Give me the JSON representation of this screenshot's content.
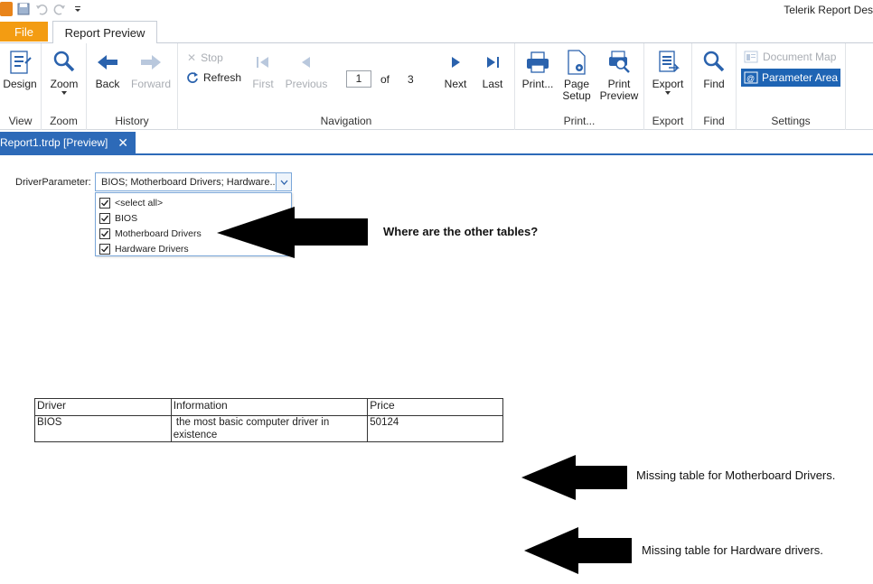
{
  "window": {
    "title": "Telerik Report Des"
  },
  "ribbon_tabs": {
    "file": "File",
    "active": "Report Preview"
  },
  "ribbon": {
    "view": {
      "design": "Design",
      "group": "View"
    },
    "zoom": {
      "zoom": "Zoom",
      "group": "Zoom"
    },
    "history": {
      "back": "Back",
      "forward": "Forward",
      "group": "History"
    },
    "navigation": {
      "stop": "Stop",
      "refresh": "Refresh",
      "first": "First",
      "previous": "Previous",
      "page_value": "1",
      "of": "of",
      "total_pages": "3",
      "next": "Next",
      "last": "Last",
      "group": "Navigation"
    },
    "print": {
      "print": "Print...",
      "page_setup_1": "Page",
      "page_setup_2": "Setup",
      "print_preview_1": "Print",
      "print_preview_2": "Preview",
      "group": "Print..."
    },
    "export": {
      "export": "Export",
      "group": "Export"
    },
    "find": {
      "find": "Find",
      "group": "Find"
    },
    "settings": {
      "document_map": "Document Map",
      "parameter_area": "Parameter Area",
      "group": "Settings"
    }
  },
  "document_tab": {
    "label": "Report1.trdp [Preview]",
    "close": "✕"
  },
  "parameters": {
    "label": "DriverParameter:",
    "value": "BIOS; Motherboard Drivers; Hardware...",
    "options": [
      {
        "label": "<select all>",
        "checked": true
      },
      {
        "label": "BIOS",
        "checked": true
      },
      {
        "label": "Motherboard Drivers",
        "checked": true
      },
      {
        "label": "Hardware Drivers",
        "checked": true
      }
    ]
  },
  "annotations": {
    "question": "Where are the other tables?",
    "missing_motherboard": "Missing table for Motherboard Drivers.",
    "missing_hardware": "Missing table for Hardware drivers."
  },
  "report_table": {
    "headers": [
      "Driver",
      "Information",
      "Price"
    ],
    "rows": [
      [
        "BIOS",
        " the most basic computer driver in existence",
        "50124"
      ]
    ]
  },
  "colors": {
    "file_tab": "#f39c12",
    "accent_blue": "#2d6ab8",
    "parameter_area_bg": "#1e64b4",
    "icon_blue": "#2a62ad"
  }
}
